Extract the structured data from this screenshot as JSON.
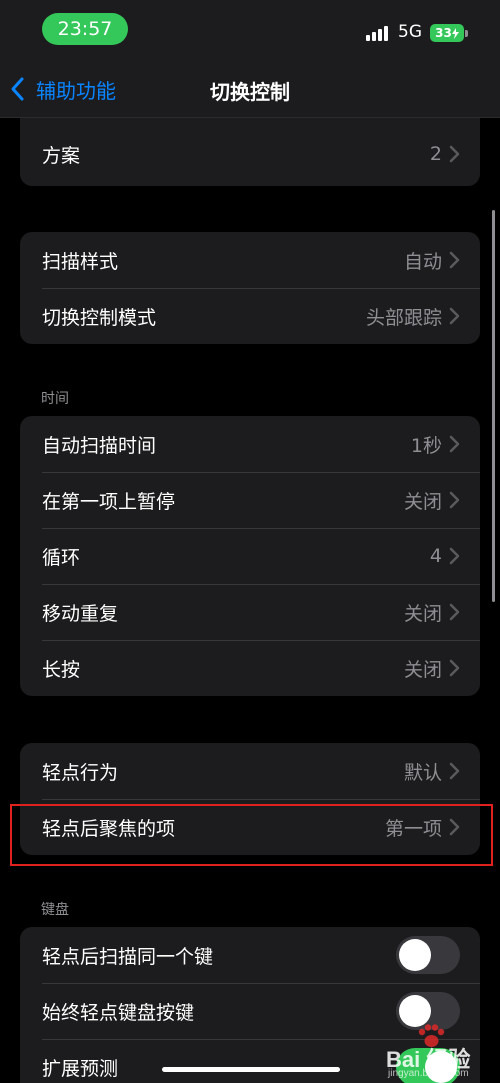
{
  "status_bar": {
    "time": "23:57",
    "network": "5G",
    "battery": "33",
    "accent": "#34c759"
  },
  "nav": {
    "back_label": "辅助功能",
    "title": "切换控制"
  },
  "groups": {
    "scheme": {
      "rows": [
        {
          "label": "方案",
          "value": "2"
        }
      ]
    },
    "style": {
      "rows": [
        {
          "label": "扫描样式",
          "value": "自动"
        },
        {
          "label": "切换控制模式",
          "value": "头部跟踪"
        }
      ]
    },
    "timing": {
      "header": "时间",
      "rows": [
        {
          "label": "自动扫描时间",
          "value": "1秒"
        },
        {
          "label": "在第一项上暂停",
          "value": "关闭"
        },
        {
          "label": "循环",
          "value": "4"
        },
        {
          "label": "移动重复",
          "value": "关闭"
        },
        {
          "label": "长按",
          "value": "关闭"
        }
      ]
    },
    "tap": {
      "rows": [
        {
          "label": "轻点行为",
          "value": "默认"
        },
        {
          "label": "轻点后聚焦的项",
          "value": "第一项"
        }
      ]
    },
    "keyboard": {
      "header": "键盘",
      "rows": [
        {
          "label": "轻点后扫描同一个键",
          "toggle": "off"
        },
        {
          "label": "始终轻点键盘按键",
          "toggle": "off"
        },
        {
          "label": "扩展预测",
          "toggle": "on"
        }
      ]
    }
  },
  "watermark": {
    "brand": "Bai 经验",
    "url": "jingyan.baidu.com"
  }
}
